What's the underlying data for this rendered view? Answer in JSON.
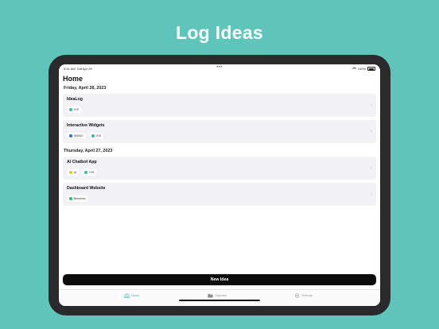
{
  "promo": {
    "title": "Log Ideas"
  },
  "status_bar": {
    "time": "9:41 AM",
    "date": "Sat Apr 29",
    "battery": "100%"
  },
  "page_title": "Home",
  "sections": [
    {
      "date": "Friday, April 28, 2023",
      "ideas": [
        {
          "title": "IdeaLog",
          "tags": [
            {
              "label": "iOS",
              "color": "#3bb8ae"
            }
          ]
        },
        {
          "title": "Interactive Widgets",
          "tags": [
            {
              "label": "WWDC",
              "color": "#2a6fd6"
            },
            {
              "label": "iOS",
              "color": "#3bb8ae"
            }
          ]
        }
      ]
    },
    {
      "date": "Thursday, April 27, 2023",
      "ideas": [
        {
          "title": "AI Chatbot App",
          "tags": [
            {
              "label": "AI",
              "color": "#f2c12e"
            },
            {
              "label": "iOS",
              "color": "#3bb8ae"
            }
          ]
        },
        {
          "title": "Dashboard Website",
          "tags": [
            {
              "label": "Business",
              "color": "#34b96a"
            }
          ]
        }
      ]
    }
  ],
  "new_idea_label": "New Idea",
  "tabs": [
    {
      "label": "Home",
      "icon": "house-icon",
      "active": true
    },
    {
      "label": "Organize",
      "icon": "folder-icon",
      "active": false
    },
    {
      "label": "Settings",
      "icon": "gear-icon",
      "active": false
    }
  ],
  "colors": {
    "accent": "#3bb8ae",
    "background": "#5fc4b9",
    "button": "#0d0d0d"
  }
}
